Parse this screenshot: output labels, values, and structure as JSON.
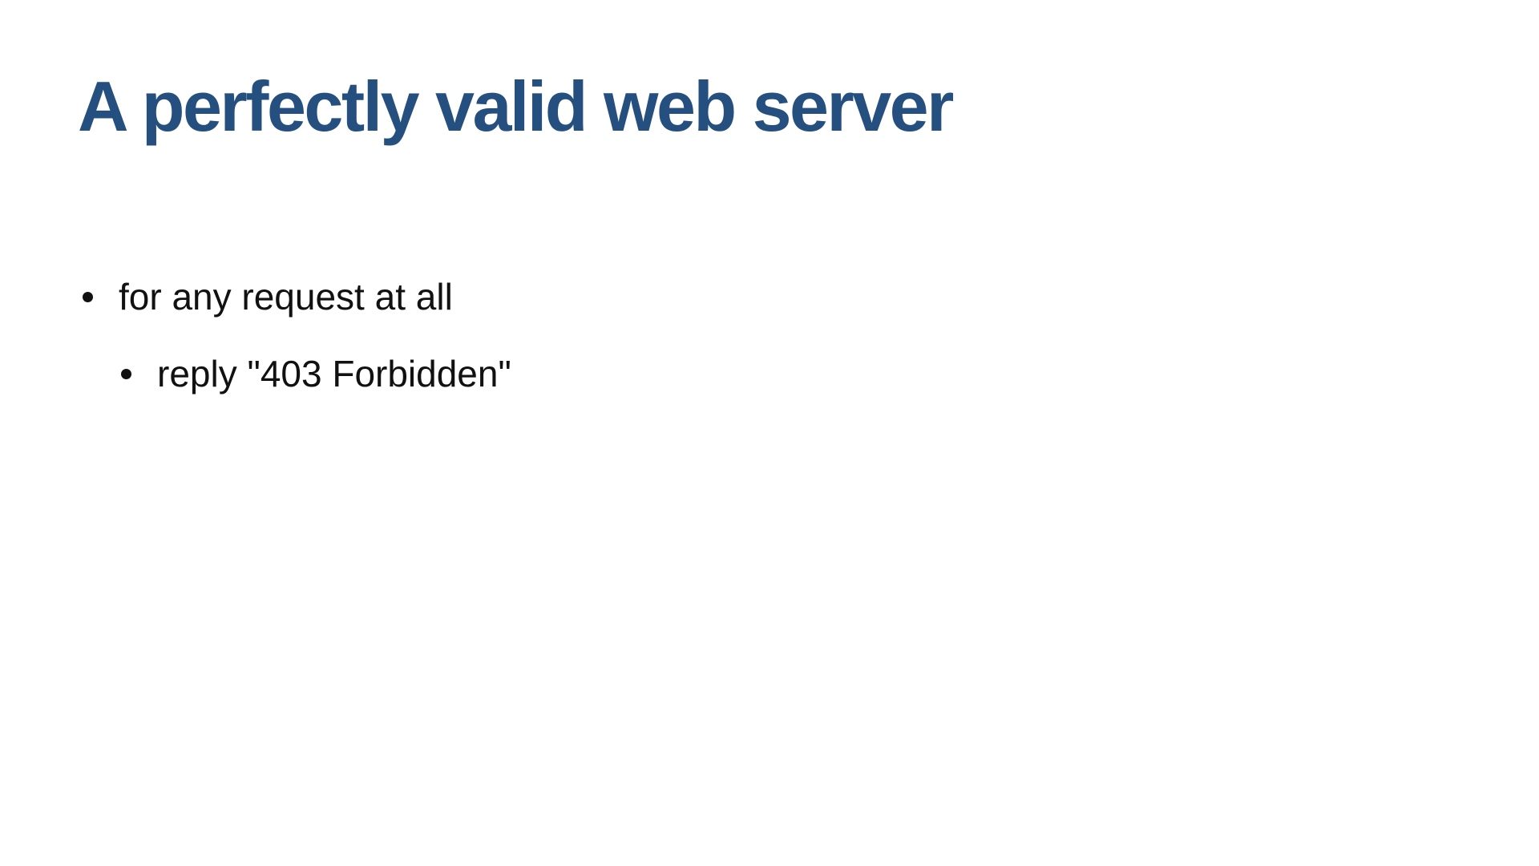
{
  "slide": {
    "title": "A perfectly valid web server",
    "bullets": [
      {
        "text": "for any request at all",
        "children": [
          {
            "text": "reply \"403 Forbidden\""
          }
        ]
      }
    ]
  },
  "colors": {
    "title": "#244f7f",
    "body_text": "#111111",
    "background": "#ffffff"
  }
}
